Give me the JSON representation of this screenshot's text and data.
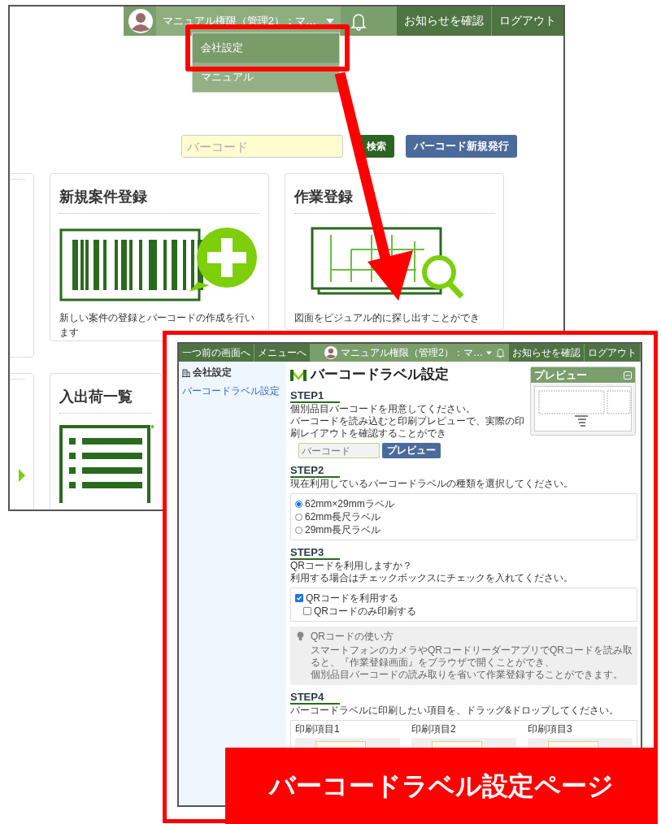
{
  "back_screen": {
    "header": {
      "user_name": "マニュアル権限（管理2）：マ…",
      "notices_button": "お知らせを確認",
      "logout_button": "ログアウト"
    },
    "user_menu": [
      {
        "label": "会社設定",
        "selected": true
      },
      {
        "label": "マニュアル",
        "selected": false
      }
    ],
    "search": {
      "placeholder": "バーコード",
      "search_button": "検索",
      "new_button": "バーコード新規発行"
    },
    "cards": [
      {
        "kind": "partial"
      },
      {
        "kind": "barcode",
        "title": "新規案件登録",
        "description": "新しい案件の登録とバーコードの作成を行います"
      },
      {
        "kind": "drawing-search",
        "title": "作業登録",
        "description": "図面をビジュアル的に探し出すことができ"
      },
      {
        "kind": "partial-arrow"
      },
      {
        "kind": "list",
        "title": "入出荷一覧"
      }
    ]
  },
  "front_screen": {
    "header": {
      "back_button": "一つ前の画面へ",
      "menu_button": "メニューへ",
      "user_name": "マニュアル権限（管理2）：マ…",
      "notices_button": "お知らせを確認",
      "logout_button": "ログアウト"
    },
    "sidebar": {
      "heading": "会社設定",
      "items": [
        {
          "label": "バーコードラベル設定"
        }
      ]
    },
    "page_title": "バーコードラベル設定",
    "preview": {
      "title": "プレビュー"
    },
    "steps": [
      {
        "kind": "barcode",
        "title": "STEP1",
        "lines": [
          "個別品目バーコードを用意してください。",
          "バーコードを読み込むと印刷プレビューで、実際の印刷レイアウトを確認することができ"
        ],
        "placeholder": "バーコード",
        "button": "プレビュー"
      },
      {
        "kind": "radio",
        "title": "STEP2",
        "lines": [
          "現在利用しているバーコードラベルの種類を選択してください。"
        ],
        "options": [
          {
            "label": "62mm×29mmラベル",
            "selected": true
          },
          {
            "label": "62mm長尺ラベル",
            "selected": false
          },
          {
            "label": "29mm長尺ラベル",
            "selected": false
          }
        ]
      },
      {
        "kind": "checkbox",
        "title": "STEP3",
        "lines": [
          "QRコードを利用しますか？",
          "利用する場合はチェックボックスにチェックを入れてください。"
        ],
        "options": [
          {
            "label": "QRコードを利用する",
            "checked": true,
            "children": [
              {
                "label": "QRコードのみ印刷する",
                "checked": false
              }
            ]
          }
        ],
        "tip": {
          "title": "QRコードの使い方",
          "lines": [
            "スマートフォンのカメラやQRコードリーダーアプリでQRコードを読み取ると、『作業登録画面』をブラウザで開くことができ、",
            "個別品目バーコードの読み取りを省いて作業登録することができます。"
          ]
        }
      },
      {
        "kind": "columns",
        "title": "STEP4",
        "lines": [
          "バーコードラベルに印刷したい項目を、ドラッグ&ドロップしてください。"
        ],
        "columns": [
          "印刷項目1",
          "印刷項目2",
          "印刷項目3"
        ]
      }
    ]
  },
  "caption": "バーコードラベル設定ページ"
}
